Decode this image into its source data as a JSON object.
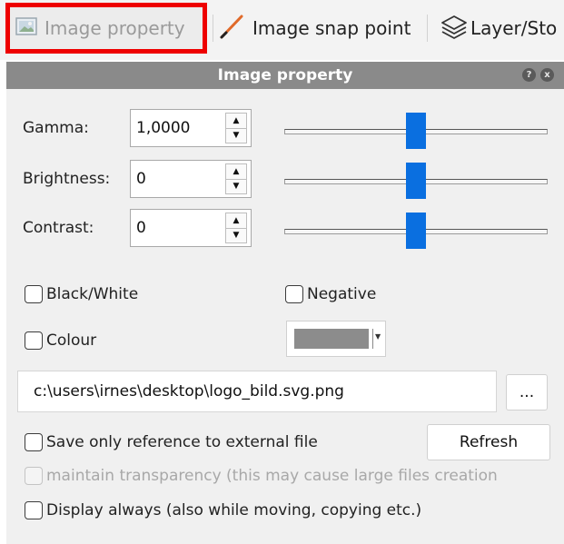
{
  "toolbar": {
    "image_property": "Image property",
    "image_snap_point": "Image snap point",
    "layer_store": "Layer/Sto"
  },
  "dock": {
    "title": "Image property",
    "help_glyph": "?",
    "close_glyph": "x"
  },
  "fields": {
    "gamma": {
      "label": "Gamma:",
      "value": "1,0000",
      "slider_fraction": 0.5
    },
    "brightness": {
      "label": "Brightness:",
      "value": "0",
      "slider_fraction": 0.5
    },
    "contrast": {
      "label": "Contrast:",
      "value": "0",
      "slider_fraction": 0.5
    }
  },
  "options": {
    "black_white": "Black/White",
    "negative": "Negative",
    "colour": "Colour",
    "colour_value": "#8c8c8c"
  },
  "file": {
    "path": "c:\\users\\irnes\\desktop\\logo_bild.svg.png",
    "browse": "..."
  },
  "save_reference": "Save only reference to external file",
  "refresh": "Refresh",
  "maintain_transparency": "maintain transparency (this may cause large files creation",
  "display_always": "Display always (also while moving, copying etc.)",
  "colors": {
    "accent": "#0a6fe0",
    "highlight": "#ee0000",
    "title_bar": "#8a8a8a"
  }
}
